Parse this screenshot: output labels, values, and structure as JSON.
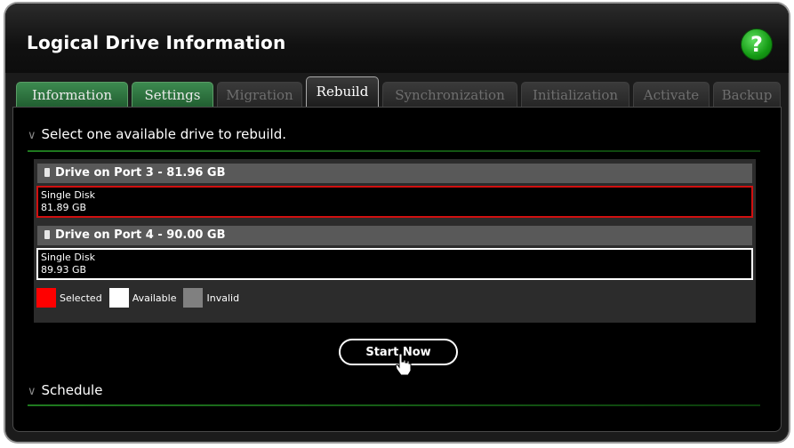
{
  "window": {
    "title": "Logical Drive Information",
    "help_label": "?"
  },
  "tabs": [
    {
      "label": "Information",
      "state": "enabled"
    },
    {
      "label": "Settings",
      "state": "enabled"
    },
    {
      "label": "Migration",
      "state": "disabled"
    },
    {
      "label": "Rebuild",
      "state": "active"
    },
    {
      "label": "Synchronization",
      "state": "disabled"
    },
    {
      "label": "Initialization",
      "state": "disabled"
    },
    {
      "label": "Activate",
      "state": "disabled"
    },
    {
      "label": "Backup",
      "state": "disabled"
    }
  ],
  "rebuild": {
    "section_title": "Select one available drive to rebuild.",
    "drives": [
      {
        "header": "Drive on Port 3 - 81.96 GB",
        "type": "Single Disk",
        "size": "81.89 GB",
        "status": "selected"
      },
      {
        "header": "Drive on Port 4 - 90.00 GB",
        "type": "Single Disk",
        "size": "89.93 GB",
        "status": "available"
      }
    ],
    "legend": [
      {
        "label": "Selected",
        "color": "#ff0000"
      },
      {
        "label": "Available",
        "color": "#ffffff"
      },
      {
        "label": "Invalid",
        "color": "#808080"
      }
    ],
    "start_label": "Start Now"
  },
  "schedule": {
    "section_title": "Schedule"
  },
  "colors": {
    "accent_green": "#1f7a1f",
    "selected_border": "#d01010"
  }
}
